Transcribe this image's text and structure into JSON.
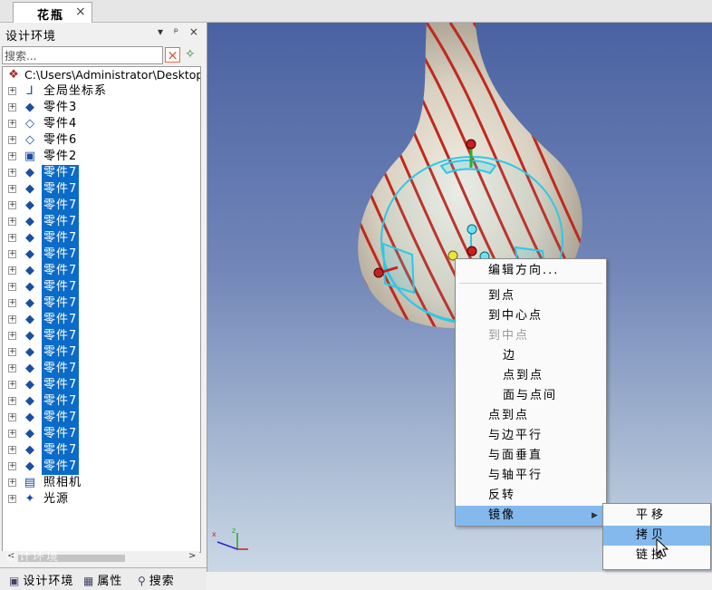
{
  "document_tab": {
    "title": "花瓶",
    "close": "×"
  },
  "panel": {
    "title": "设计环境",
    "buttons": [
      "▾",
      "ᵖ",
      "×"
    ],
    "search_placeholder": "搜索...",
    "search_clear": "×"
  },
  "tree": {
    "root": "C:\\Users\\Administrator\\Desktop",
    "items": [
      {
        "label": "全局坐标系",
        "icon": "axis-icon",
        "glyph": "⅃",
        "selected": false
      },
      {
        "label": "零件3",
        "icon": "part-icon",
        "glyph": "◆",
        "selected": false
      },
      {
        "label": "零件4",
        "icon": "shape-outline-icon",
        "glyph": "◇",
        "selected": false
      },
      {
        "label": "零件6",
        "icon": "shape-outline-icon",
        "glyph": "◇",
        "selected": false
      },
      {
        "label": "零件2",
        "icon": "image-part-icon",
        "glyph": "▣",
        "selected": false
      },
      {
        "label": "零件7",
        "icon": "part-icon",
        "glyph": "◆",
        "selected": true
      },
      {
        "label": "零件7",
        "icon": "part-icon",
        "glyph": "◆",
        "selected": true
      },
      {
        "label": "零件7",
        "icon": "part-icon",
        "glyph": "◆",
        "selected": true
      },
      {
        "label": "零件7",
        "icon": "part-icon",
        "glyph": "◆",
        "selected": true
      },
      {
        "label": "零件7",
        "icon": "part-icon",
        "glyph": "◆",
        "selected": true
      },
      {
        "label": "零件7",
        "icon": "part-icon",
        "glyph": "◆",
        "selected": true
      },
      {
        "label": "零件7",
        "icon": "part-icon",
        "glyph": "◆",
        "selected": true
      },
      {
        "label": "零件7",
        "icon": "part-icon",
        "glyph": "◆",
        "selected": true
      },
      {
        "label": "零件7",
        "icon": "part-icon",
        "glyph": "◆",
        "selected": true
      },
      {
        "label": "零件7",
        "icon": "part-icon",
        "glyph": "◆",
        "selected": true
      },
      {
        "label": "零件7",
        "icon": "part-icon",
        "glyph": "◆",
        "selected": true
      },
      {
        "label": "零件7",
        "icon": "part-icon",
        "glyph": "◆",
        "selected": true
      },
      {
        "label": "零件7",
        "icon": "part-icon",
        "glyph": "◆",
        "selected": true
      },
      {
        "label": "零件7",
        "icon": "part-icon",
        "glyph": "◆",
        "selected": true
      },
      {
        "label": "零件7",
        "icon": "part-icon",
        "glyph": "◆",
        "selected": true
      },
      {
        "label": "零件7",
        "icon": "part-icon",
        "glyph": "◆",
        "selected": true
      },
      {
        "label": "零件7",
        "icon": "part-icon",
        "glyph": "◆",
        "selected": true
      },
      {
        "label": "零件7",
        "icon": "part-icon",
        "glyph": "◆",
        "selected": true
      },
      {
        "label": "零件7",
        "icon": "part-icon",
        "glyph": "◆",
        "selected": true
      },
      {
        "label": "照相机",
        "icon": "camera-icon",
        "glyph": "▤",
        "selected": false
      },
      {
        "label": "光源",
        "icon": "light-icon",
        "glyph": "✦",
        "selected": false
      }
    ]
  },
  "bottom_tabs": [
    {
      "label": "设计环境",
      "icon": "design-env-icon",
      "glyph": "▣"
    },
    {
      "label": "属性",
      "icon": "properties-icon",
      "glyph": "▦"
    },
    {
      "label": "搜索",
      "icon": "search-icon",
      "glyph": "⚲"
    }
  ],
  "context_menu": {
    "items": [
      {
        "label": "编辑方向...",
        "indent": 0,
        "disabled": false
      },
      {
        "separator": true
      },
      {
        "label": "到点",
        "indent": 0,
        "disabled": false
      },
      {
        "label": "到中心点",
        "indent": 0,
        "disabled": false
      },
      {
        "label": "到中点",
        "indent": 0,
        "disabled": true
      },
      {
        "label": "边",
        "indent": 1,
        "disabled": false
      },
      {
        "label": "点到点",
        "indent": 1,
        "disabled": false
      },
      {
        "label": "面与点间",
        "indent": 1,
        "disabled": false
      },
      {
        "label": "点到点",
        "indent": 0,
        "disabled": false
      },
      {
        "label": "与边平行",
        "indent": 0,
        "disabled": false
      },
      {
        "label": "与面垂直",
        "indent": 0,
        "disabled": false
      },
      {
        "label": "与轴平行",
        "indent": 0,
        "disabled": false
      },
      {
        "label": "反转",
        "indent": 0,
        "disabled": false
      },
      {
        "label": "镜像",
        "indent": 0,
        "disabled": false,
        "highlighted": true,
        "submenu": true
      }
    ]
  },
  "submenu": {
    "items": [
      {
        "label": "平移",
        "highlighted": false
      },
      {
        "label": "拷贝",
        "highlighted": true
      },
      {
        "label": "链接",
        "highlighted": false
      }
    ]
  },
  "watermark": "设计环境",
  "colors": {
    "selection": "#0a6bc8",
    "menu_highlight": "#84b9ee",
    "stripe": "#c0281c",
    "gizmo": "#2cc8e6"
  }
}
